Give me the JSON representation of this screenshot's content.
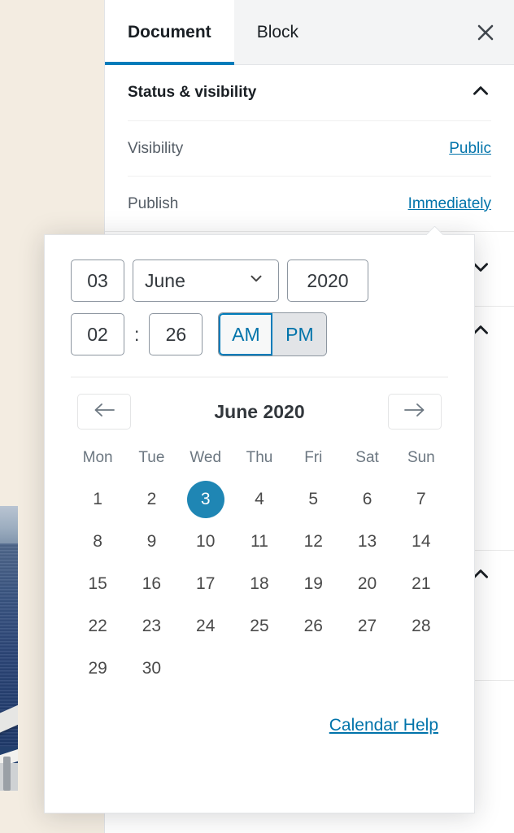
{
  "tabs": [
    {
      "label": "Document",
      "active": true
    },
    {
      "label": "Block",
      "active": false
    }
  ],
  "close_icon": "close-icon",
  "panel": {
    "title": "Status & visibility",
    "collapse_icon": "chevron-up-icon",
    "rows": [
      {
        "label": "Visibility",
        "value": "Public"
      },
      {
        "label": "Publish",
        "value": "Immediately"
      }
    ]
  },
  "datepicker": {
    "day": "03",
    "month": "June",
    "month_chevron": "chevron-down-icon",
    "year": "2020",
    "hour": "02",
    "separator": ":",
    "minute": "26",
    "am_label": "AM",
    "pm_label": "PM",
    "am_selected": true,
    "calendar": {
      "prev_icon": "arrow-left-icon",
      "next_icon": "arrow-right-icon",
      "title": "June 2020",
      "weekdays": [
        "Mon",
        "Tue",
        "Wed",
        "Thu",
        "Fri",
        "Sat",
        "Sun"
      ],
      "weeks": [
        [
          "1",
          "2",
          "3",
          "4",
          "5",
          "6",
          "7"
        ],
        [
          "8",
          "9",
          "10",
          "11",
          "12",
          "13",
          "14"
        ],
        [
          "15",
          "16",
          "17",
          "18",
          "19",
          "20",
          "21"
        ],
        [
          "22",
          "23",
          "24",
          "25",
          "26",
          "27",
          "28"
        ],
        [
          "29",
          "30",
          "",
          "",
          "",
          "",
          ""
        ]
      ],
      "selected_day": "3"
    },
    "help_link": "Calendar Help"
  },
  "colors": {
    "accent": "#007cba",
    "link": "#0073aa",
    "selected_day_bg": "#1f86b4",
    "canvas_bg": "#f3ece1",
    "tabbar_bg": "#f3f4f5"
  }
}
